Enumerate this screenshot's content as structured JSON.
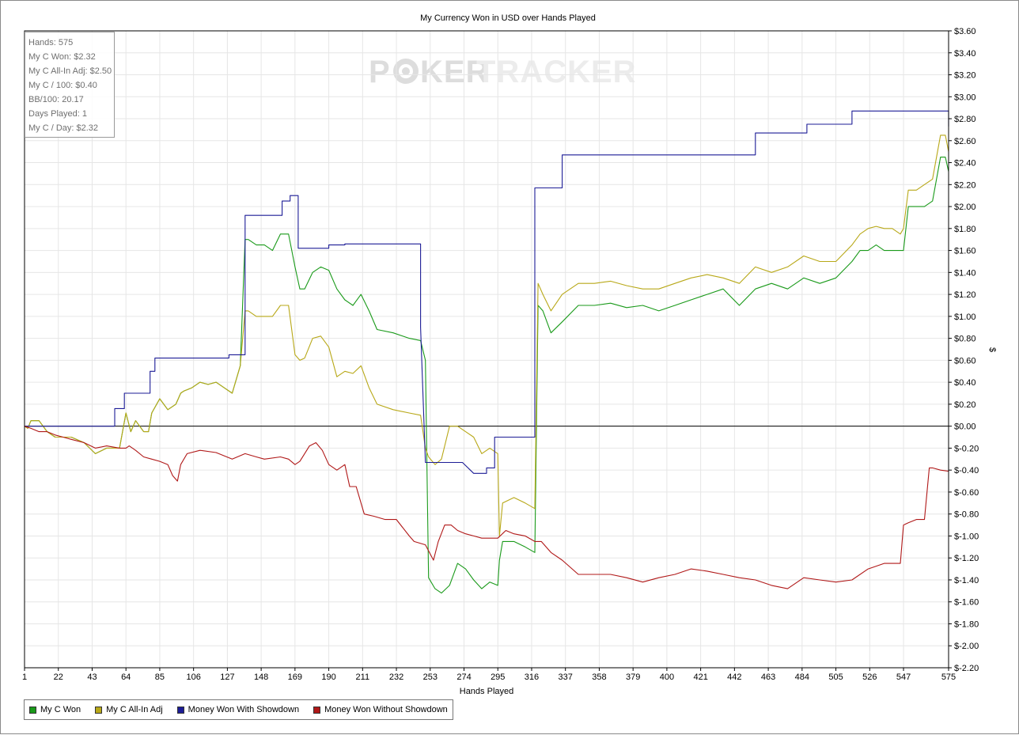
{
  "chart_data": {
    "type": "line",
    "title": "My Currency Won in USD over Hands Played",
    "xlabel": "Hands Played",
    "ylabel": "$",
    "xlim": [
      1,
      575
    ],
    "ylim": [
      -2.2,
      3.6
    ],
    "x_ticks": [
      1,
      22,
      43,
      64,
      85,
      106,
      127,
      148,
      169,
      190,
      211,
      232,
      253,
      274,
      295,
      316,
      337,
      358,
      379,
      400,
      421,
      442,
      463,
      484,
      505,
      526,
      547,
      575
    ],
    "y_ticks": [
      "$3.60",
      "$3.40",
      "$3.20",
      "$3.00",
      "$2.80",
      "$2.60",
      "$2.40",
      "$2.20",
      "$2.00",
      "$1.80",
      "$1.60",
      "$1.40",
      "$1.20",
      "$1.00",
      "$0.80",
      "$0.60",
      "$0.40",
      "$0.20",
      "$0.00",
      "$-0.20",
      "$-0.40",
      "$-0.60",
      "$-0.80",
      "$-1.00",
      "$-1.20",
      "$-1.40",
      "$-1.60",
      "$-1.80",
      "$-2.00",
      "$-2.20"
    ],
    "y_tick_values": [
      3.6,
      3.4,
      3.2,
      3.0,
      2.8,
      2.6,
      2.4,
      2.2,
      2.0,
      1.8,
      1.6,
      1.4,
      1.2,
      1.0,
      0.8,
      0.6,
      0.4,
      0.2,
      0.0,
      -0.2,
      -0.4,
      -0.6,
      -0.8,
      -1.0,
      -1.2,
      -1.4,
      -1.6,
      -1.8,
      -2.0,
      -2.2
    ],
    "grid": true,
    "legend_position": "bottom-left",
    "series": [
      {
        "name": "My C Won",
        "color": "#1a9a1a",
        "x": [
          1,
          3,
          5,
          10,
          15,
          20,
          25,
          30,
          38,
          45,
          52,
          60,
          64,
          67,
          70,
          75,
          78,
          80,
          85,
          90,
          95,
          98,
          100,
          105,
          110,
          115,
          120,
          125,
          130,
          135,
          138,
          140,
          145,
          150,
          155,
          160,
          165,
          169,
          172,
          175,
          180,
          185,
          190,
          195,
          200,
          205,
          210,
          215,
          220,
          230,
          240,
          247,
          250,
          252,
          256,
          260,
          265,
          270,
          275,
          280,
          285,
          290,
          295,
          296,
          298,
          305,
          312,
          318,
          320,
          323,
          328,
          335,
          345,
          355,
          365,
          375,
          385,
          395,
          405,
          415,
          425,
          435,
          445,
          455,
          465,
          475,
          485,
          495,
          505,
          515,
          520,
          525,
          530,
          535,
          540,
          545,
          547,
          550,
          555,
          560,
          565,
          570,
          573,
          575
        ],
        "y": [
          0,
          -0.02,
          0.05,
          0.05,
          -0.05,
          -0.1,
          -0.1,
          -0.1,
          -0.15,
          -0.25,
          -0.2,
          -0.2,
          0.12,
          -0.05,
          0.05,
          -0.05,
          -0.05,
          0.12,
          0.25,
          0.15,
          0.2,
          0.3,
          0.32,
          0.35,
          0.4,
          0.38,
          0.4,
          0.35,
          0.3,
          0.55,
          1.7,
          1.7,
          1.65,
          1.65,
          1.6,
          1.75,
          1.75,
          1.45,
          1.25,
          1.25,
          1.4,
          1.45,
          1.42,
          1.25,
          1.15,
          1.1,
          1.2,
          1.05,
          0.88,
          0.85,
          0.8,
          0.78,
          0.6,
          -1.38,
          -1.48,
          -1.52,
          -1.45,
          -1.25,
          -1.3,
          -1.4,
          -1.48,
          -1.42,
          -1.45,
          -1.22,
          -1.05,
          -1.05,
          -1.1,
          -1.15,
          1.1,
          1.05,
          0.85,
          0.95,
          1.1,
          1.1,
          1.12,
          1.08,
          1.1,
          1.05,
          1.1,
          1.15,
          1.2,
          1.25,
          1.1,
          1.25,
          1.3,
          1.25,
          1.35,
          1.3,
          1.35,
          1.5,
          1.6,
          1.6,
          1.65,
          1.6,
          1.6,
          1.6,
          1.6,
          2.0,
          2.0,
          2.0,
          2.05,
          2.45,
          2.45,
          2.32
        ]
      },
      {
        "name": "My C All-In Adj",
        "color": "#b8a818",
        "x": [
          1,
          3,
          5,
          10,
          15,
          20,
          25,
          30,
          38,
          45,
          52,
          60,
          64,
          67,
          70,
          75,
          78,
          80,
          85,
          90,
          95,
          98,
          100,
          105,
          110,
          115,
          120,
          125,
          130,
          135,
          138,
          140,
          145,
          150,
          155,
          160,
          165,
          169,
          172,
          175,
          180,
          185,
          190,
          195,
          200,
          205,
          210,
          215,
          220,
          230,
          240,
          247,
          250,
          252,
          256,
          260,
          265,
          270,
          275,
          280,
          285,
          290,
          295,
          296,
          298,
          305,
          312,
          318,
          320,
          323,
          328,
          335,
          345,
          355,
          365,
          375,
          385,
          395,
          405,
          415,
          425,
          435,
          445,
          455,
          465,
          475,
          485,
          495,
          505,
          515,
          520,
          525,
          530,
          535,
          540,
          545,
          547,
          550,
          555,
          560,
          565,
          570,
          573,
          575
        ],
        "y": [
          0,
          -0.02,
          0.05,
          0.05,
          -0.05,
          -0.1,
          -0.1,
          -0.1,
          -0.15,
          -0.25,
          -0.2,
          -0.2,
          0.12,
          -0.05,
          0.05,
          -0.05,
          -0.05,
          0.12,
          0.25,
          0.15,
          0.2,
          0.3,
          0.32,
          0.35,
          0.4,
          0.38,
          0.4,
          0.35,
          0.3,
          0.55,
          1.05,
          1.05,
          1.0,
          1.0,
          1.0,
          1.1,
          1.1,
          0.65,
          0.6,
          0.62,
          0.8,
          0.82,
          0.72,
          0.45,
          0.5,
          0.48,
          0.55,
          0.35,
          0.2,
          0.15,
          0.12,
          0.1,
          -0.2,
          -0.28,
          -0.35,
          -0.3,
          0.0,
          0.0,
          -0.05,
          -0.1,
          -0.25,
          -0.2,
          -0.25,
          -1.0,
          -0.7,
          -0.65,
          -0.7,
          -0.75,
          1.3,
          1.2,
          1.05,
          1.2,
          1.3,
          1.3,
          1.32,
          1.28,
          1.25,
          1.25,
          1.3,
          1.35,
          1.38,
          1.35,
          1.3,
          1.45,
          1.4,
          1.45,
          1.55,
          1.5,
          1.5,
          1.65,
          1.75,
          1.8,
          1.82,
          1.8,
          1.8,
          1.75,
          1.8,
          2.15,
          2.15,
          2.2,
          2.25,
          2.65,
          2.65,
          2.5
        ]
      },
      {
        "name": "Money Won With Showdown",
        "color": "#1c1c96",
        "x": [
          1,
          57,
          57,
          63,
          63,
          79,
          79,
          82,
          82,
          128,
          128,
          138,
          138,
          161,
          161,
          166,
          166,
          171,
          171,
          190,
          190,
          200,
          200,
          247,
          247,
          250,
          250,
          273,
          273,
          280,
          280,
          288,
          288,
          293,
          293,
          296,
          296,
          318,
          318,
          320,
          320,
          335,
          335,
          345,
          345,
          455,
          455,
          487,
          487,
          515,
          515,
          575,
          575
        ],
        "y": [
          0,
          0,
          0.16,
          0.16,
          0.3,
          0.3,
          0.5,
          0.5,
          0.62,
          0.62,
          0.65,
          0.65,
          1.92,
          1.92,
          2.05,
          2.05,
          2.1,
          2.1,
          1.62,
          1.62,
          1.65,
          1.65,
          1.66,
          1.66,
          0.9,
          -0.33,
          -0.33,
          -0.33,
          -0.33,
          -0.43,
          -0.43,
          -0.43,
          -0.38,
          -0.38,
          -0.1,
          -0.1,
          -0.1,
          -0.1,
          2.17,
          2.17,
          2.17,
          2.17,
          2.47,
          2.47,
          2.47,
          2.47,
          2.67,
          2.67,
          2.75,
          2.75,
          2.87,
          2.87,
          2.73
        ]
      },
      {
        "name": "Money Won Without Showdown",
        "color": "#b01818",
        "x": [
          1,
          5,
          10,
          15,
          20,
          25,
          30,
          38,
          45,
          52,
          60,
          64,
          66,
          70,
          75,
          80,
          85,
          90,
          93,
          96,
          98,
          102,
          110,
          120,
          130,
          138,
          145,
          150,
          160,
          165,
          169,
          172,
          178,
          182,
          186,
          190,
          195,
          200,
          203,
          207,
          212,
          218,
          225,
          232,
          240,
          243,
          250,
          255,
          258,
          262,
          266,
          270,
          275,
          280,
          285,
          290,
          295,
          300,
          305,
          312,
          318,
          322,
          328,
          335,
          345,
          355,
          365,
          375,
          385,
          395,
          405,
          415,
          425,
          435,
          445,
          455,
          465,
          475,
          485,
          495,
          505,
          515,
          525,
          535,
          545,
          547,
          550,
          555,
          560,
          563,
          565,
          570,
          575
        ],
        "y": [
          0,
          -0.02,
          -0.05,
          -0.05,
          -0.08,
          -0.1,
          -0.12,
          -0.15,
          -0.2,
          -0.18,
          -0.2,
          -0.2,
          -0.18,
          -0.22,
          -0.28,
          -0.3,
          -0.32,
          -0.35,
          -0.45,
          -0.5,
          -0.35,
          -0.25,
          -0.22,
          -0.24,
          -0.3,
          -0.25,
          -0.28,
          -0.3,
          -0.28,
          -0.3,
          -0.35,
          -0.32,
          -0.18,
          -0.15,
          -0.22,
          -0.35,
          -0.4,
          -0.35,
          -0.55,
          -0.55,
          -0.8,
          -0.82,
          -0.85,
          -0.85,
          -1.0,
          -1.05,
          -1.08,
          -1.22,
          -1.05,
          -0.9,
          -0.9,
          -0.95,
          -0.98,
          -1.0,
          -1.02,
          -1.02,
          -1.02,
          -0.95,
          -0.98,
          -1.0,
          -1.05,
          -1.05,
          -1.15,
          -1.22,
          -1.35,
          -1.35,
          -1.35,
          -1.38,
          -1.42,
          -1.38,
          -1.35,
          -1.3,
          -1.32,
          -1.35,
          -1.38,
          -1.4,
          -1.45,
          -1.48,
          -1.38,
          -1.4,
          -1.42,
          -1.4,
          -1.3,
          -1.25,
          -1.25,
          -0.9,
          -0.88,
          -0.85,
          -0.85,
          -0.38,
          -0.38,
          -0.4,
          -0.41
        ]
      }
    ]
  },
  "stats": {
    "hands": "Hands: 575",
    "c_won": "My C Won: $2.32",
    "allin_adj": "My C All-In Adj: $2.50",
    "per_100": "My C / 100: $0.40",
    "bb_100": "BB/100: 20.17",
    "days_played": "Days Played: 1",
    "per_day": "My C / Day: $2.32"
  },
  "watermark": {
    "text_left": "P",
    "text_mid": "KER",
    "text_right": "TRACKER"
  },
  "legend": {
    "items": [
      {
        "label": "My C Won",
        "color": "#1a9a1a"
      },
      {
        "label": "My C All-In Adj",
        "color": "#b8a818"
      },
      {
        "label": "Money Won With Showdown",
        "color": "#1c1c96"
      },
      {
        "label": "Money Won Without Showdown",
        "color": "#b01818"
      }
    ]
  }
}
